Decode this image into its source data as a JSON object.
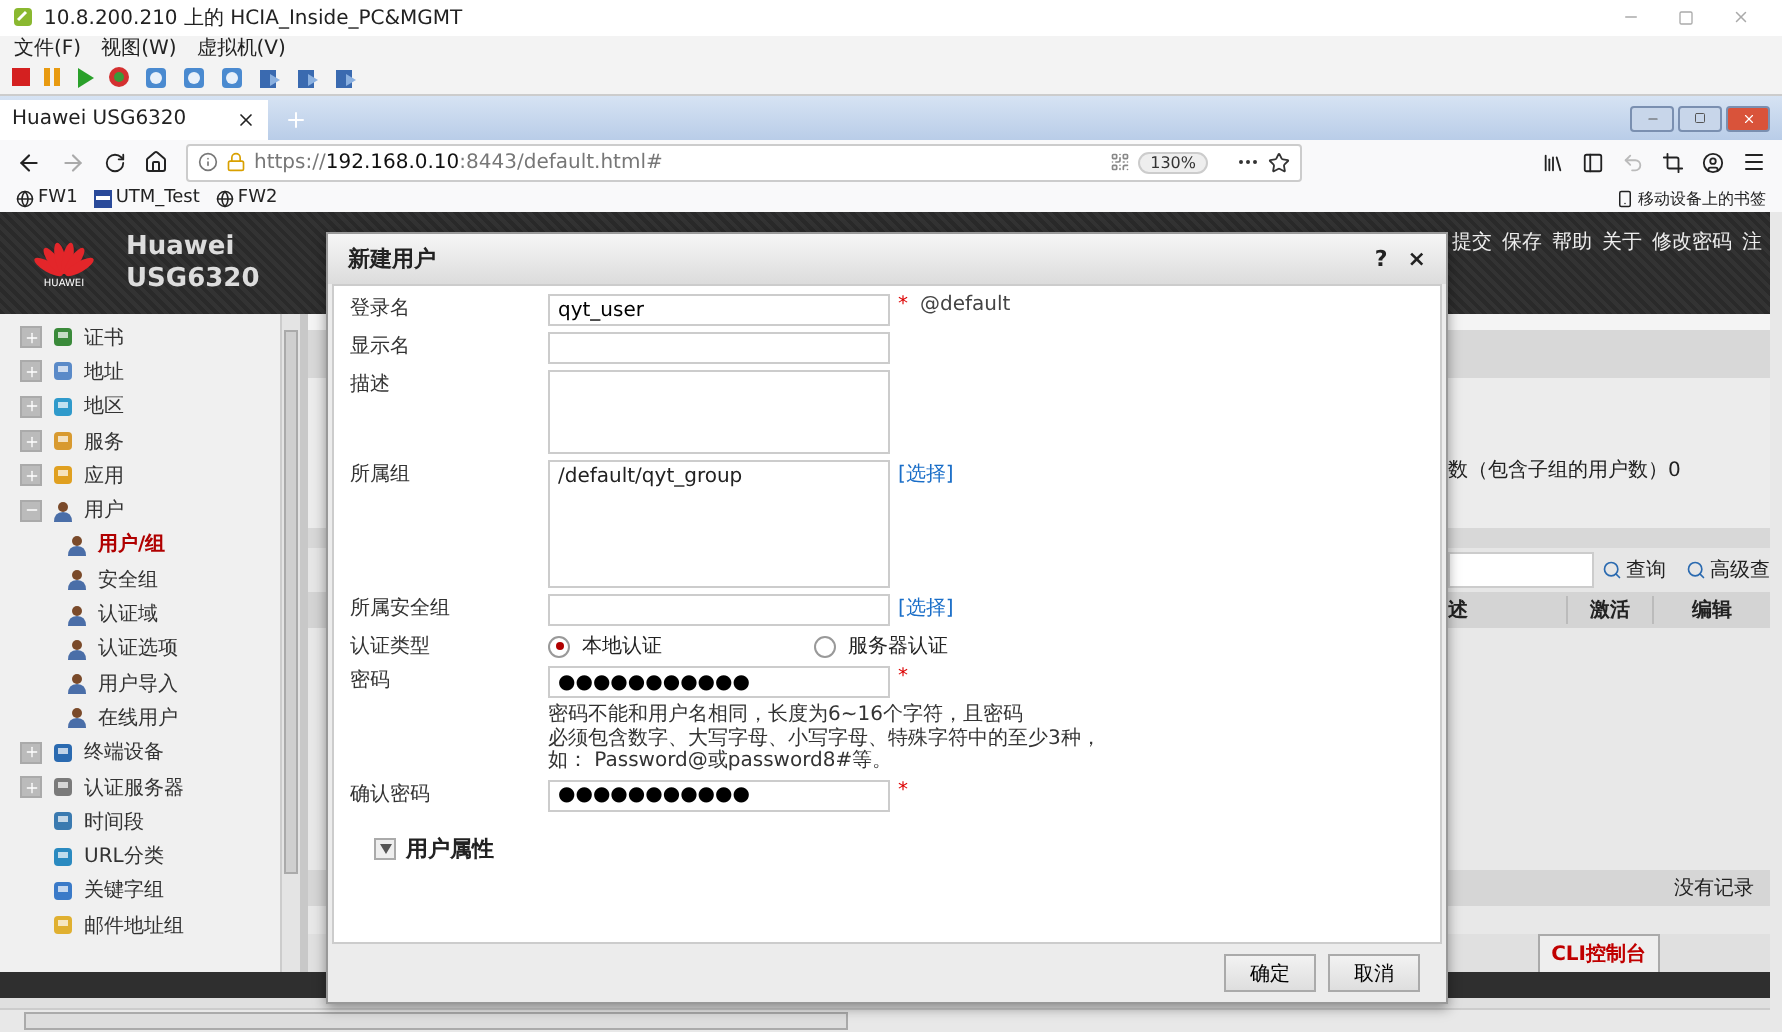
{
  "vm_window": {
    "title": "10.8.200.210 上的 HCIA_Inside_PC&MGMT",
    "menu": [
      "文件(F)",
      "视图(W)",
      "虚拟机(V)"
    ]
  },
  "browser": {
    "tabs": [
      {
        "label": "Huawei USG6320",
        "selected": true
      }
    ],
    "url_scheme": "https://",
    "url_host": "192.168.0.10",
    "url_rest": ":8443/default.html#",
    "zoom": "130%",
    "bookmarks": [
      {
        "label": "FW1",
        "kind": "globe"
      },
      {
        "label": "UTM_Test",
        "kind": "page"
      },
      {
        "label": "FW2",
        "kind": "globe"
      }
    ],
    "mobile_bookmarks": "移动设备上的书签"
  },
  "app": {
    "logo_text": "HUAWEI",
    "brand": "Huawei",
    "model": "USG6320",
    "top_menu": [
      "提交",
      "保存",
      "帮助",
      "关于",
      "修改密码",
      "注"
    ]
  },
  "sidebar": {
    "items": [
      {
        "label": "证书",
        "kind": "group",
        "expanded": false,
        "selected": false
      },
      {
        "label": "地址",
        "kind": "group",
        "expanded": false,
        "selected": false
      },
      {
        "label": "地区",
        "kind": "group",
        "expanded": false,
        "selected": false
      },
      {
        "label": "服务",
        "kind": "group",
        "expanded": false,
        "selected": false
      },
      {
        "label": "应用",
        "kind": "group",
        "expanded": false,
        "selected": false
      },
      {
        "label": "用户",
        "kind": "group",
        "expanded": true,
        "selected": false,
        "children": [
          {
            "label": "用户/组",
            "selected": true
          },
          {
            "label": "安全组",
            "selected": false
          },
          {
            "label": "认证域",
            "selected": false
          },
          {
            "label": "认证选项",
            "selected": false
          },
          {
            "label": "用户导入",
            "selected": false
          },
          {
            "label": "在线用户",
            "selected": false
          }
        ]
      },
      {
        "label": "终端设备",
        "kind": "group",
        "expanded": false,
        "selected": false
      },
      {
        "label": "认证服务器",
        "kind": "group",
        "expanded": false,
        "selected": false
      },
      {
        "label": "时间段",
        "kind": "leaf",
        "selected": false
      },
      {
        "label": "URL分类",
        "kind": "leaf",
        "selected": false
      },
      {
        "label": "关键字组",
        "kind": "leaf",
        "selected": false
      },
      {
        "label": "邮件地址组",
        "kind": "leaf",
        "selected": false
      }
    ]
  },
  "background": {
    "summary": "数（包含子组的用户数）0",
    "search_buttons": [
      "查询",
      "高级查"
    ],
    "columns": [
      "述",
      "激活",
      "编辑"
    ],
    "empty_text": "没有记录",
    "console_tab": "CLI控制台"
  },
  "dialog": {
    "title": "新建用户",
    "help": "?",
    "close": "×",
    "fields": [
      {
        "kind": "text",
        "label": "登录名",
        "value": "qyt_user",
        "mark": "*",
        "suffix": "@default"
      },
      {
        "kind": "text",
        "label": "显示名"
      },
      {
        "kind": "textarea",
        "label": "描述"
      },
      {
        "kind": "list",
        "label": "所属组",
        "value": "/default/qyt_group",
        "link": "[选择]"
      },
      {
        "kind": "text",
        "label": "所属安全组",
        "link": "[选择]"
      },
      {
        "kind": "radio",
        "label": "认证类型",
        "options": [
          {
            "label": "本地认证",
            "selected": true
          },
          {
            "label": "服务器认证",
            "selected": false
          }
        ]
      },
      {
        "kind": "text",
        "label": "密码",
        "value": "●●●●●●●●●●●",
        "mark": "*",
        "hint": [
          "密码不能和用户名相同，长度为6~16个字符，且密码",
          "必须包含数字、大写字母、小写字母、特殊字符中的至少3种，",
          "如： Password@或password8#等。"
        ]
      },
      {
        "kind": "text",
        "label": "确认密码",
        "value": "●●●●●●●●●●●",
        "mark": "*"
      }
    ],
    "section": {
      "label": "用户属性",
      "expanded": false
    },
    "buttons": [
      "确定",
      "取消"
    ]
  }
}
